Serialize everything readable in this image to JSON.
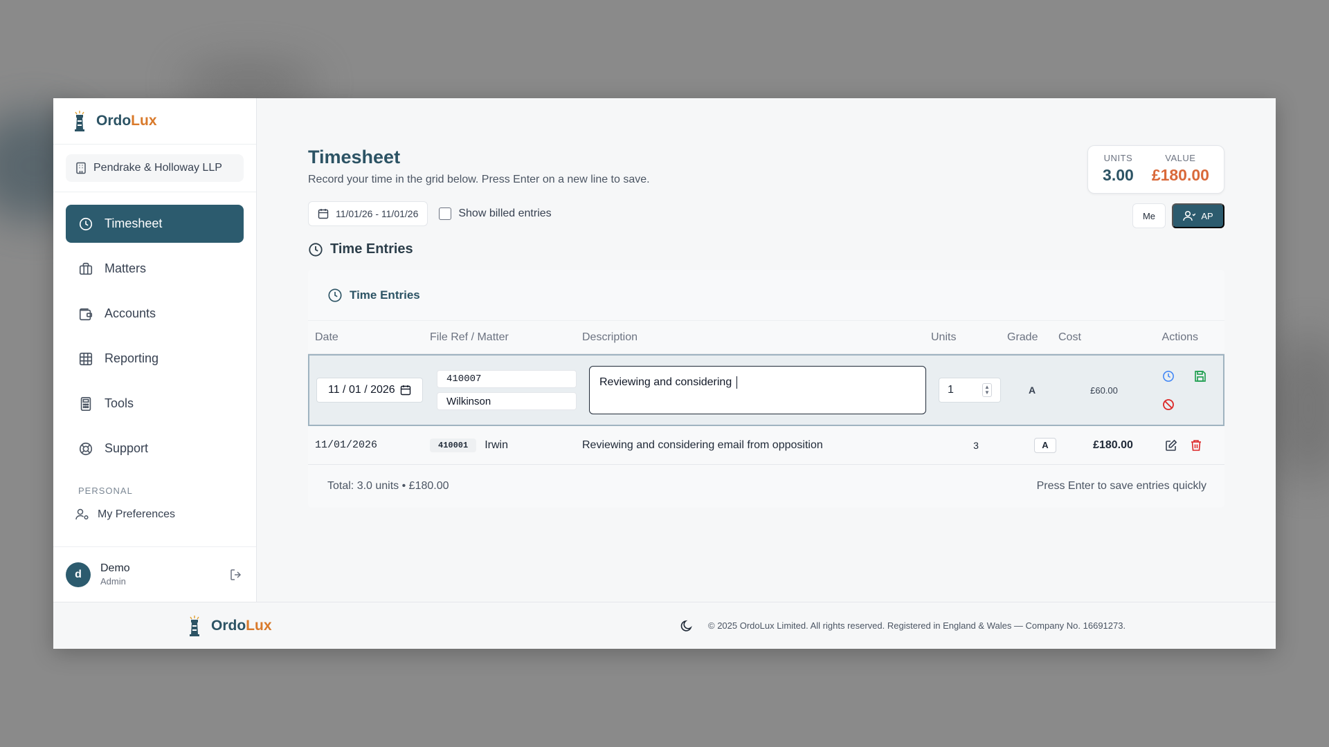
{
  "brand": {
    "name_part1": "Ordo",
    "name_part2": "Lux",
    "accent_color": "#d97a2b",
    "primary_color": "#2c5b6e"
  },
  "firm": {
    "name": "Pendrake & Holloway LLP"
  },
  "nav": {
    "items": [
      {
        "label": "Timesheet",
        "icon": "clock-icon",
        "active": true
      },
      {
        "label": "Matters",
        "icon": "briefcase-icon"
      },
      {
        "label": "Accounts",
        "icon": "wallet-icon"
      },
      {
        "label": "Reporting",
        "icon": "table-icon"
      },
      {
        "label": "Tools",
        "icon": "calculator-icon"
      },
      {
        "label": "Support",
        "icon": "lifebuoy-icon"
      }
    ],
    "section_label": "PERSONAL",
    "preferences_label": "My Preferences"
  },
  "user": {
    "initial": "d",
    "name": "Demo",
    "role": "Admin"
  },
  "page": {
    "title": "Timesheet",
    "subtitle": "Record your time in the grid below. Press Enter on a new line to save.",
    "date_range": "11/01/26 - 11/01/26",
    "show_billed_label": "Show billed entries",
    "toggle_me": "Me",
    "toggle_ap": "AP",
    "section_title": "Time Entries"
  },
  "stats": {
    "units_label": "UNITS",
    "units_value": "3.00",
    "value_label": "VALUE",
    "value_value": "£180.00"
  },
  "entries": {
    "panel_title": "Time Entries",
    "columns": [
      "Date",
      "File Ref / Matter",
      "Description",
      "Units",
      "Grade",
      "Cost",
      "Actions"
    ],
    "edit_row": {
      "date": "11 / 01 / 2026",
      "file_ref": "410007",
      "matter": "Wilkinson",
      "description": "Reviewing and considering ",
      "units": "1",
      "grade": "A",
      "cost": "£60.00"
    },
    "rows": [
      {
        "date": "11/01/2026",
        "file_ref": "410001",
        "matter": "Irwin",
        "description": "Reviewing and considering email from opposition",
        "units": "3",
        "grade": "A",
        "cost": "£180.00"
      }
    ],
    "total": "Total: 3.0 units • £180.00",
    "hint": "Press Enter to save entries quickly"
  },
  "footer": {
    "copyright": "© 2025 OrdoLux Limited. All rights reserved. Registered in England & Wales — Company No. 16691273."
  }
}
